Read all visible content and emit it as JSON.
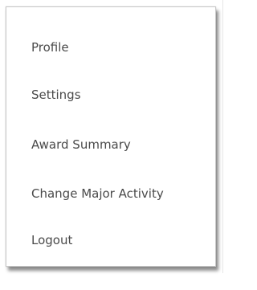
{
  "user_menu": {
    "items": [
      {
        "label": "Profile"
      },
      {
        "label": "Settings"
      },
      {
        "label": "Award Summary"
      },
      {
        "label": "Change Major Activity"
      },
      {
        "label": "Logout"
      }
    ]
  }
}
